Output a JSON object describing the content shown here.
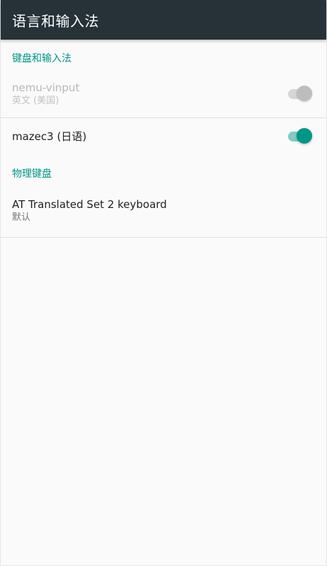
{
  "appbar": {
    "title": "语言和输入法"
  },
  "sections": {
    "keyboards": {
      "header": "键盘和输入法"
    },
    "physical": {
      "header": "物理键盘"
    }
  },
  "items": {
    "nemu": {
      "title": "nemu-vinput",
      "summary": "英文 (美国)",
      "enabled": false,
      "checked": true
    },
    "mazec": {
      "title": "mazec3 (日语)",
      "enabled": true,
      "checked": true
    },
    "at_keyboard": {
      "title": "AT Translated Set 2 keyboard",
      "summary": "默认"
    }
  },
  "colors": {
    "appbar": "#263238",
    "accent": "#009688",
    "accent_light": "#80cbc4",
    "background": "#fafafa"
  }
}
